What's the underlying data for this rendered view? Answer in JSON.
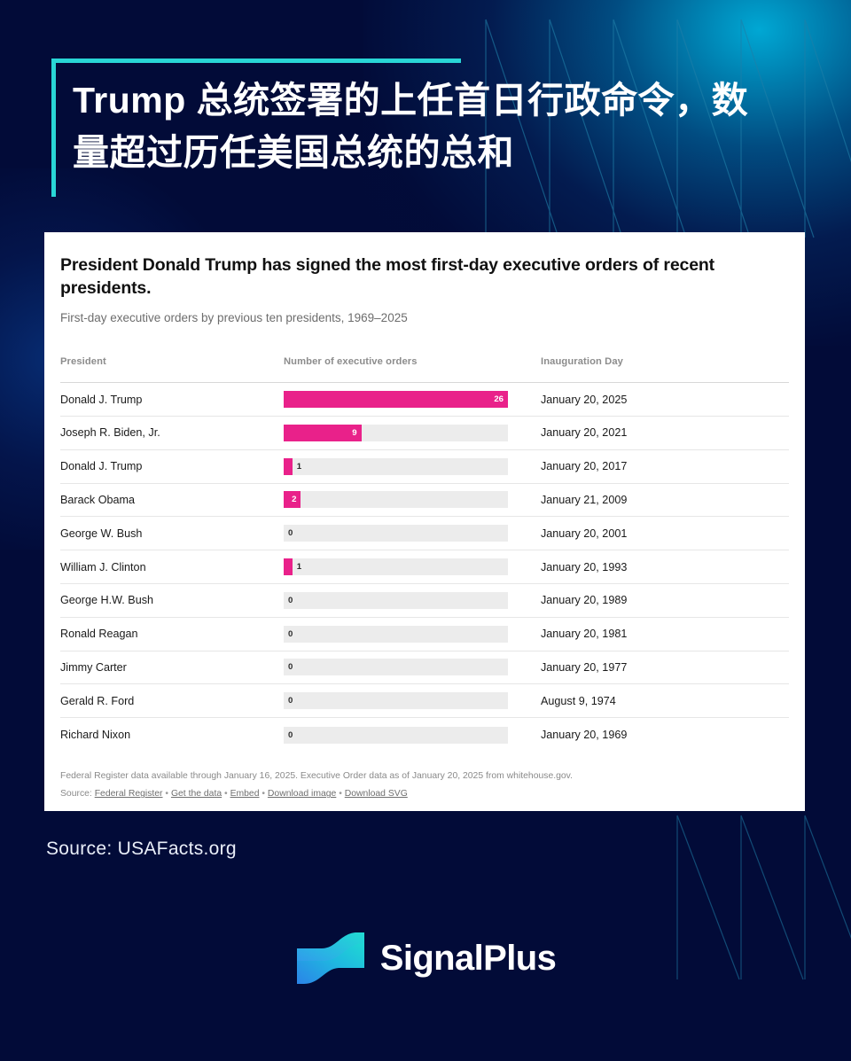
{
  "headline": "Trump 总统签署的上任首日行政命令，数量超过历任美国总统的总和",
  "colors": {
    "background": "#020b38",
    "accent_cyan": "#29d6d6",
    "bar_pink": "#e9218a",
    "bar_track": "#ececec",
    "card_background": "#ffffff",
    "logo_gradient_start": "#2b84e8",
    "logo_gradient_end": "#1fe0d0"
  },
  "card": {
    "title": "President Donald Trump has signed the most first-day executive orders of recent presidents.",
    "subtitle": "First-day executive orders by previous ten presidents, 1969–2025",
    "columns": {
      "president": "President",
      "orders": "Number of executive orders",
      "inauguration": "Inauguration Day"
    },
    "notes": {
      "disclaimer": "Federal Register data available through January 16, 2025. Executive Order data as of January 20, 2025 from whitehouse.gov.",
      "source_label": "Source:",
      "links": [
        "Federal Register",
        "Get the data",
        "Embed",
        "Download image",
        "Download SVG"
      ],
      "separator": "•"
    }
  },
  "chart_data": {
    "type": "bar",
    "title": "President Donald Trump has signed the most first-day executive orders of recent presidents.",
    "subtitle": "First-day executive orders by previous ten presidents, 1969–2025",
    "orientation": "horizontal",
    "xlabel": "Number of executive orders",
    "ylabel": "President",
    "xlim": [
      0,
      26
    ],
    "grid": false,
    "legend": false,
    "categories": [
      "Donald J. Trump",
      "Joseph R. Biden, Jr.",
      "Donald J. Trump",
      "Barack Obama",
      "George W. Bush",
      "William J. Clinton",
      "George H.W. Bush",
      "Ronald Reagan",
      "Jimmy Carter",
      "Gerald R. Ford",
      "Richard Nixon"
    ],
    "values": [
      26,
      9,
      1,
      2,
      0,
      1,
      0,
      0,
      0,
      0,
      0
    ],
    "inauguration_days": [
      "January 20, 2025",
      "January 20, 2021",
      "January 20, 2017",
      "January 21, 2009",
      "January 20, 2001",
      "January 20, 1993",
      "January 20, 1989",
      "January 20, 1981",
      "January 20, 1977",
      "August 9, 1974",
      "January 20, 1969"
    ],
    "rows": [
      {
        "president": "Donald J. Trump",
        "orders": 26,
        "orders_label": "26",
        "inauguration": "January 20, 2025",
        "label_inside": true
      },
      {
        "president": "Joseph R. Biden, Jr.",
        "orders": 9,
        "orders_label": "9",
        "inauguration": "January 20, 2021",
        "label_inside": true
      },
      {
        "president": "Donald J. Trump",
        "orders": 1,
        "orders_label": "1",
        "inauguration": "January 20, 2017",
        "label_inside": false
      },
      {
        "president": "Barack Obama",
        "orders": 2,
        "orders_label": "2",
        "inauguration": "January 21, 2009",
        "label_inside": true
      },
      {
        "president": "George W. Bush",
        "orders": 0,
        "orders_label": "0",
        "inauguration": "January 20, 2001",
        "label_inside": false
      },
      {
        "president": "William J. Clinton",
        "orders": 1,
        "orders_label": "1",
        "inauguration": "January 20, 1993",
        "label_inside": false
      },
      {
        "president": "George H.W. Bush",
        "orders": 0,
        "orders_label": "0",
        "inauguration": "January 20, 1989",
        "label_inside": false
      },
      {
        "president": "Ronald Reagan",
        "orders": 0,
        "orders_label": "0",
        "inauguration": "January 20, 1981",
        "label_inside": false
      },
      {
        "president": "Jimmy Carter",
        "orders": 0,
        "orders_label": "0",
        "inauguration": "January 20, 1977",
        "label_inside": false
      },
      {
        "president": "Gerald R. Ford",
        "orders": 0,
        "orders_label": "0",
        "inauguration": "August 9, 1974",
        "label_inside": false
      },
      {
        "president": "Richard Nixon",
        "orders": 0,
        "orders_label": "0",
        "inauguration": "January 20, 1969",
        "label_inside": false
      }
    ]
  },
  "footer": {
    "source": "Source: USAFacts.org",
    "brand": "SignalPlus"
  }
}
